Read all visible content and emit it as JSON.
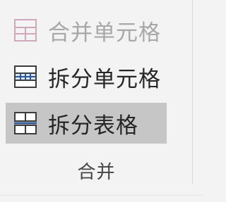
{
  "group": {
    "label": "合并",
    "items": [
      {
        "label": "合并单元格",
        "icon": "merge-cells-icon",
        "state": "disabled"
      },
      {
        "label": "拆分单元格",
        "icon": "split-cells-icon",
        "state": "enabled"
      },
      {
        "label": "拆分表格",
        "icon": "split-table-icon",
        "state": "hovered"
      }
    ]
  },
  "colors": {
    "background": "#f3f3f3",
    "hover": "#c6c6c6",
    "icon_blue": "#2b579a",
    "disabled_text": "#a8a8a8"
  }
}
